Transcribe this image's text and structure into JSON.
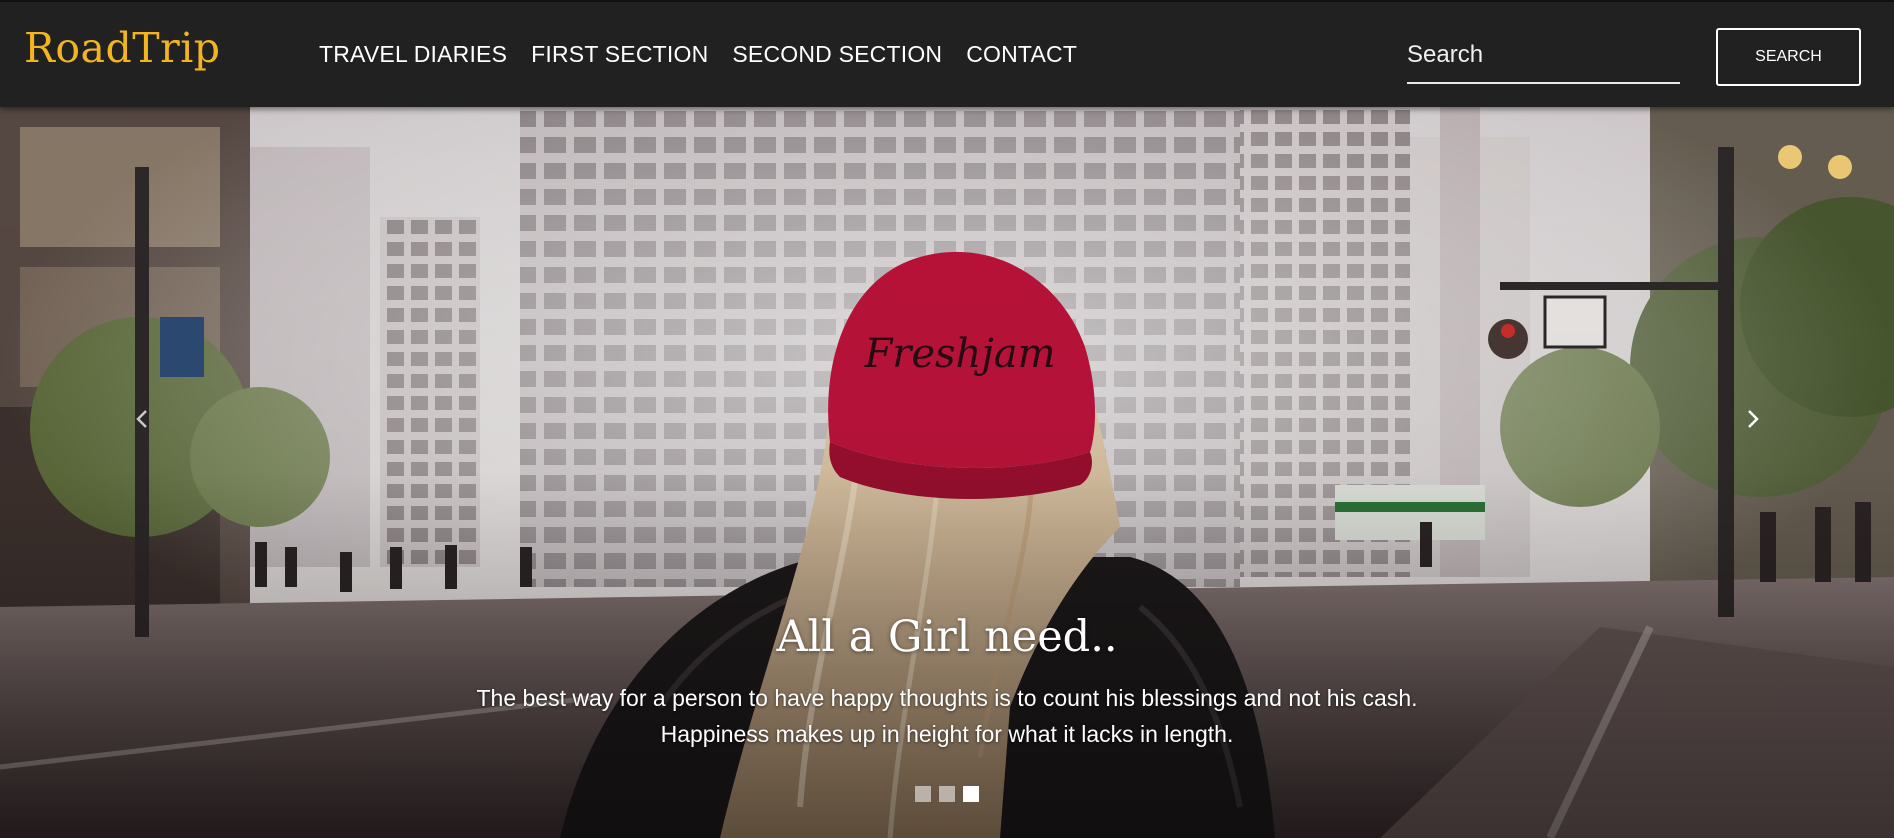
{
  "navbar": {
    "brand": "RoadTrip",
    "links": [
      "TRAVEL DIARIES",
      "FIRST SECTION",
      "SECOND SECTION",
      "CONTACT"
    ],
    "search_placeholder": "Search",
    "search_button": "SEARCH"
  },
  "carousel": {
    "caption_title": "All a Girl need..",
    "caption_line1": "The best way for a person to have happy thoughts is to count his blessings and not his cash.",
    "caption_line2": "Happiness makes up in height for what it lacks in length.",
    "slide_count": 3,
    "active_slide": 3,
    "hero_image": "city-street-girl-red-cap-photo",
    "icons": {
      "prev": "chevron-left-icon",
      "next": "chevron-right-icon"
    }
  },
  "colors": {
    "navbar_bg": "#212121",
    "brand": "#f2b51f",
    "text": "#ffffff",
    "cap": "#c2133c"
  }
}
